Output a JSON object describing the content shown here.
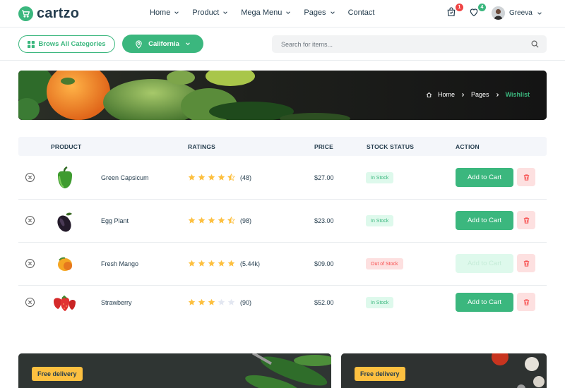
{
  "brand": {
    "name": "cartzo",
    "accent": "#3bb77e",
    "text": "#253d4e"
  },
  "nav": [
    {
      "label": "Home",
      "has_dropdown": true
    },
    {
      "label": "Product",
      "has_dropdown": true
    },
    {
      "label": "Mega Menu",
      "has_dropdown": true
    },
    {
      "label": "Pages",
      "has_dropdown": true
    },
    {
      "label": "Contact",
      "has_dropdown": false
    }
  ],
  "header_icons": {
    "cart": {
      "icon": "shopping-bag-icon",
      "count": "1"
    },
    "wishlist": {
      "icon": "heart-icon",
      "count": "4"
    }
  },
  "user": {
    "name": "Greeva"
  },
  "toolbar": {
    "categories_label": "Brows All Categories",
    "location_label": "California",
    "search_placeholder": "Search for items..."
  },
  "breadcrumb": {
    "home": "Home",
    "pages": "Pages",
    "current": "Wishlist"
  },
  "table": {
    "headers": {
      "product": "PRODUCT",
      "ratings": "RATINGS",
      "price": "PRICE",
      "stock": "STOCK STATUS",
      "action": "ACTION"
    },
    "rows": [
      {
        "name": "Green Capsicum",
        "stars": 4.5,
        "reviews": "(48)",
        "price": "$27.00",
        "stock": "In Stock",
        "in_stock": true,
        "action": "Add to Cart"
      },
      {
        "name": "Egg Plant",
        "stars": 4.5,
        "reviews": "(98)",
        "price": "$23.00",
        "stock": "In Stock",
        "in_stock": true,
        "action": "Add to Cart"
      },
      {
        "name": "Fresh Mango",
        "stars": 5,
        "reviews": "(5.44k)",
        "price": "$09.00",
        "stock": "Out of Stock",
        "in_stock": false,
        "action": "Add to Cart"
      },
      {
        "name": "Strawberry",
        "stars": 3,
        "reviews": "(90)",
        "price": "$52.00",
        "stock": "In Stock",
        "in_stock": true,
        "action": "Add to Cart"
      }
    ]
  },
  "promos": [
    {
      "badge": "Free delivery"
    },
    {
      "badge": "Free delivery"
    }
  ]
}
